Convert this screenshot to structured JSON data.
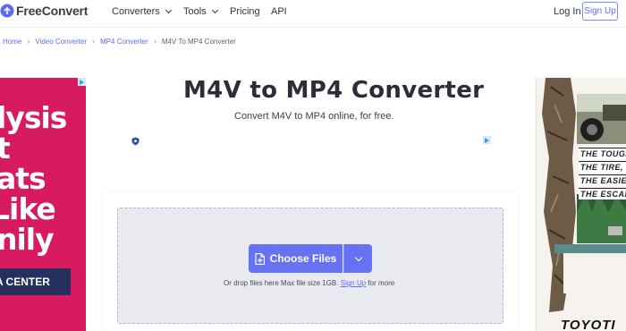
{
  "header": {
    "logo": "FreeConvert",
    "nav": [
      {
        "label": "Converters",
        "dropdown": true
      },
      {
        "label": "Tools",
        "dropdown": true
      },
      {
        "label": "Pricing",
        "dropdown": false
      },
      {
        "label": "API",
        "dropdown": false
      }
    ],
    "login": "Log In",
    "signup": "Sign Up"
  },
  "breadcrumb": [
    "Home",
    "Video Converter",
    "MP4 Converter",
    "M4V To MP4 Converter"
  ],
  "page": {
    "title": "M4V to MP4 Converter",
    "subtitle": "Convert M4V to MP4 online, for free."
  },
  "converter": {
    "choose_label": "Choose Files",
    "hint_prefix": "Or drop files here Max file size 1GB.",
    "hint_link": "Sign Up",
    "hint_suffix": "for more"
  },
  "ad_left": {
    "lines": [
      "lysis",
      "t",
      "ats",
      " Like",
      "nily"
    ],
    "button": "A CENTER"
  },
  "ad_right": {
    "lines": [
      "THE TOUGH",
      "THE TIRE,",
      "THE EASIER",
      "THE ESCAP"
    ],
    "brand": "TOYOTI"
  },
  "colors": {
    "accent": "#6672f2",
    "ad_left_bg": "#d81b5e",
    "ad_left_button": "#25305f"
  }
}
